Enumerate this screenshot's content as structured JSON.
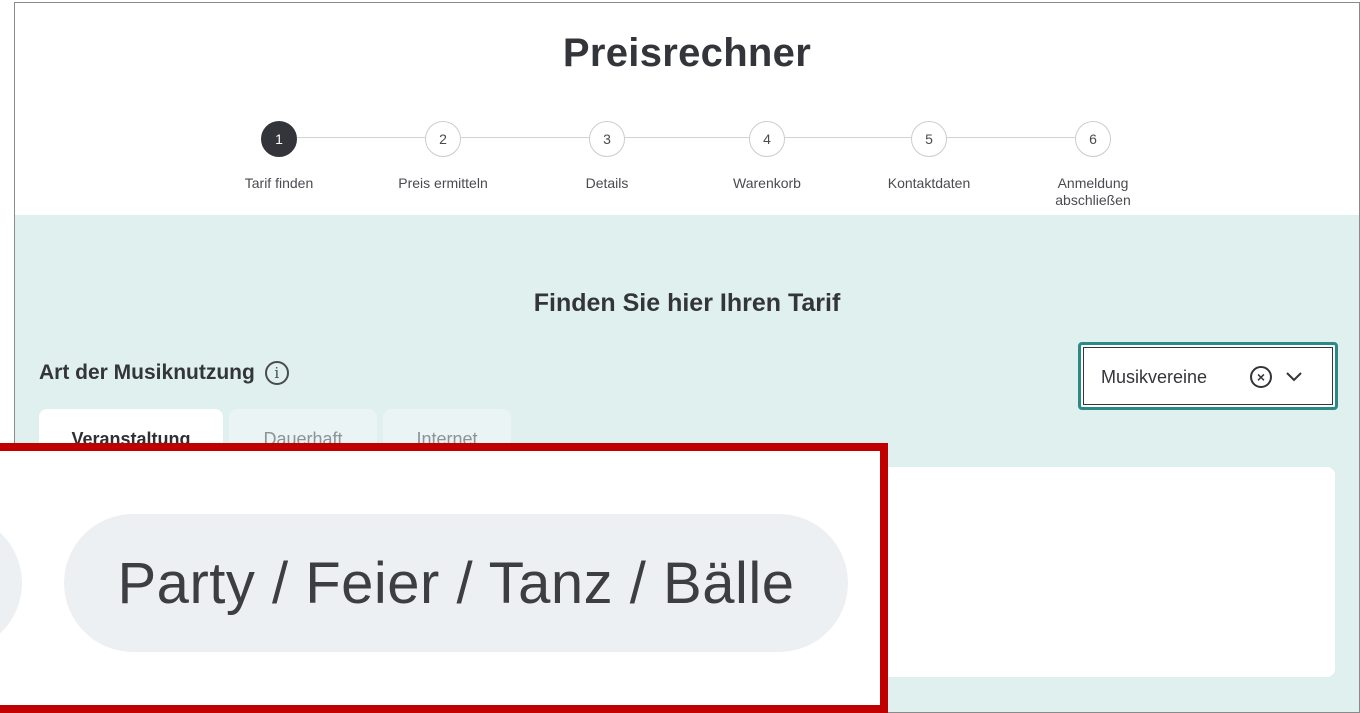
{
  "header": {
    "title": "Preisrechner"
  },
  "stepper": {
    "steps": [
      {
        "number": "1",
        "label": "Tarif finden",
        "active": true
      },
      {
        "number": "2",
        "label": "Preis ermitteln",
        "active": false
      },
      {
        "number": "3",
        "label": "Details",
        "active": false
      },
      {
        "number": "4",
        "label": "Warenkorb",
        "active": false
      },
      {
        "number": "5",
        "label": "Kontaktdaten",
        "active": false
      },
      {
        "number": "6",
        "label": "Anmeldung\nabschließen",
        "active": false
      }
    ]
  },
  "main": {
    "subtitle": "Finden Sie hier Ihren Tarif",
    "usage_label": "Art der Musiknutzung",
    "info_icon": "info-icon",
    "select": {
      "value": "Musikvereine",
      "clear_icon": "clear-circle-icon",
      "chevron_icon": "chevron-down-icon"
    },
    "tabs": [
      {
        "label": "Veranstaltung",
        "active": true
      },
      {
        "label": "Dauerhaft",
        "active": false
      },
      {
        "label": "Internet",
        "active": false
      }
    ]
  },
  "zoom_callout": {
    "pill_label": "Party / Feier / Tanz / Bälle",
    "highlight_color": "#c00000"
  },
  "colors": {
    "accent_teal": "#2a8a86",
    "panel_background": "#dff0ef",
    "active_step": "#34353a"
  }
}
